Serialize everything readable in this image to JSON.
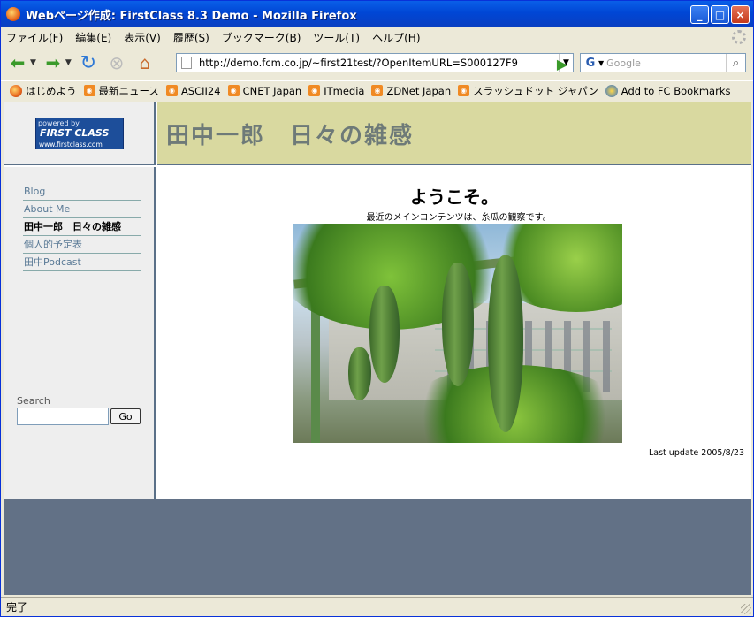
{
  "window": {
    "title": "Webページ作成: FirstClass 8.3 Demo - Mozilla Firefox",
    "minimize": "_",
    "maximize": "□",
    "close": "×"
  },
  "menu": [
    "ファイル(F)",
    "編集(E)",
    "表示(V)",
    "履歴(S)",
    "ブックマーク(B)",
    "ツール(T)",
    "ヘルプ(H)"
  ],
  "nav": {
    "url": "http://demo.fcm.co.jp/~first21test/?OpenItemURL=S000127F9",
    "search_placeholder": "Google",
    "search_engine": "G"
  },
  "bookmarks": [
    "はじめよう",
    "最新ニュース",
    "ASCII24",
    "CNET Japan",
    "ITmedia",
    "ZDNet Japan",
    "スラッシュドット ジャパン",
    "Add to FC Bookmarks"
  ],
  "page": {
    "logo": {
      "top": "powered by",
      "main": "FIRST CLASS",
      "url": "www.firstclass.com"
    },
    "site_title": "田中一郎　日々の雑感",
    "sidebar_links": [
      "Blog",
      "About Me",
      "田中一郎　日々の雑感",
      "個人的予定表",
      "田中Podcast"
    ],
    "search_label": "Search",
    "search_go": "Go",
    "welcome": "ようこそ。",
    "subtitle": "最近のメインコンテンツは、糸瓜の観察です。",
    "last_update": "Last update 2005/8/23"
  },
  "status": "完了"
}
